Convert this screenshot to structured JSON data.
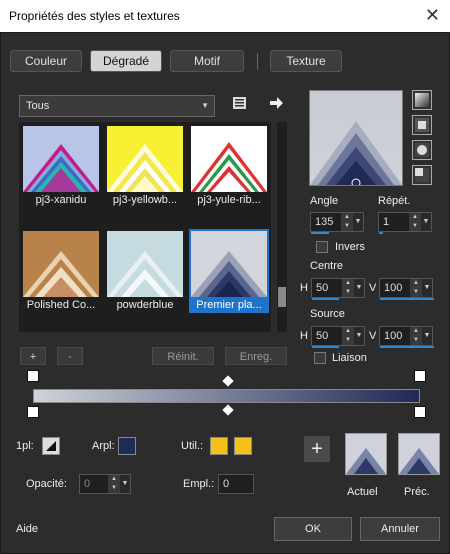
{
  "window": {
    "title": "Propriétés des styles et textures",
    "close": "✕"
  },
  "tabs": [
    "Couleur",
    "Dégradé",
    "Motif",
    "Texture"
  ],
  "category": "Tous",
  "thumbnails": [
    {
      "label": "pj3-xanidu"
    },
    {
      "label": "pj3-yellowb..."
    },
    {
      "label": "pj3-yule-rib..."
    },
    {
      "label": "Polished Co..."
    },
    {
      "label": "powderblue"
    },
    {
      "label": "Premier pla..."
    }
  ],
  "list_buttons": {
    "add": "+",
    "remove": "-",
    "reset": "Réinit.",
    "save": "Enreg."
  },
  "angle": {
    "label": "Angle",
    "value": "135"
  },
  "repeat": {
    "label": "Répét.",
    "value": "1"
  },
  "invert": {
    "label": "Invers"
  },
  "center": {
    "label": "Centre",
    "h_label": "H",
    "h": "50",
    "v_label": "V",
    "v": "100"
  },
  "source": {
    "label": "Source",
    "h_label": "H",
    "h": "50",
    "v_label": "V",
    "v": "100"
  },
  "link": {
    "label": "Liaison"
  },
  "stops": {
    "fg_label": "1pl:",
    "bg_label": "Arpl:",
    "user_label": "Util.:",
    "opacity_label": "Opacité:",
    "opacity_value": "0",
    "location_label": "Empl.:",
    "location_value": "0"
  },
  "colors": {
    "gradient_start": "#d0d3da",
    "gradient_end": "#1f2a55",
    "user": "#f2c21b",
    "accent": "#1e74c8"
  },
  "preview_labels": {
    "current": "Actuel",
    "previous": "Préc."
  },
  "add_swatch": "+",
  "footer": {
    "help": "Aide",
    "ok": "OK",
    "cancel": "Annuler"
  }
}
